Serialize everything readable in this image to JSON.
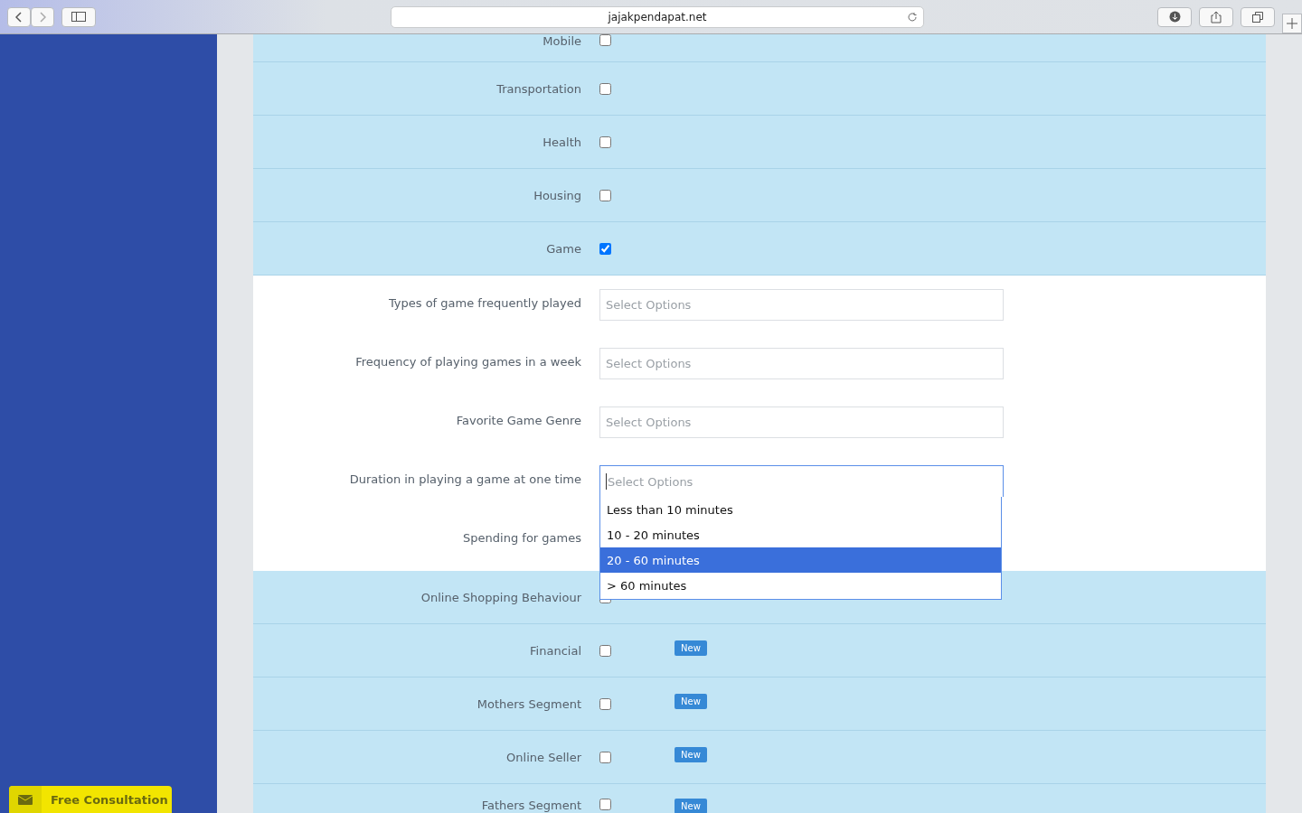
{
  "browser": {
    "url": "jajakpendapat.net"
  },
  "category_rows": [
    {
      "label": "Mobile",
      "checked": false
    },
    {
      "label": "Transportation",
      "checked": false
    },
    {
      "label": "Health",
      "checked": false
    },
    {
      "label": "Housing",
      "checked": false
    },
    {
      "label": "Game",
      "checked": true
    }
  ],
  "game_questions": [
    {
      "label": "Types of game frequently played",
      "kind": "select",
      "placeholder": "Select Options"
    },
    {
      "label": "Frequency of playing games in a week",
      "kind": "select",
      "placeholder": "Select Options"
    },
    {
      "label": "Favorite Game Genre",
      "kind": "select",
      "placeholder": "Select Options"
    },
    {
      "label": "Duration in playing a game at one time",
      "kind": "open",
      "placeholder": "Select Options",
      "options": [
        {
          "label": "Less than 10 minutes",
          "selected": false
        },
        {
          "label": "10 - 20 minutes",
          "selected": false
        },
        {
          "label": "20 - 60 minutes",
          "selected": true
        },
        {
          "label": "> 60 minutes",
          "selected": false
        }
      ]
    },
    {
      "label": "Spending for games",
      "kind": "hidden"
    }
  ],
  "more_rows": [
    {
      "label": "Online Shopping Behaviour",
      "checked": false
    },
    {
      "label": "Financial",
      "checked": false,
      "badge": "New"
    },
    {
      "label": "Mothers Segment",
      "checked": false,
      "badge": "New"
    },
    {
      "label": "Online Seller",
      "checked": false,
      "badge": "New"
    },
    {
      "label": "Fathers Segment",
      "checked": false,
      "badge": "New"
    }
  ],
  "consultation_button": {
    "label": "Free Consultation"
  }
}
